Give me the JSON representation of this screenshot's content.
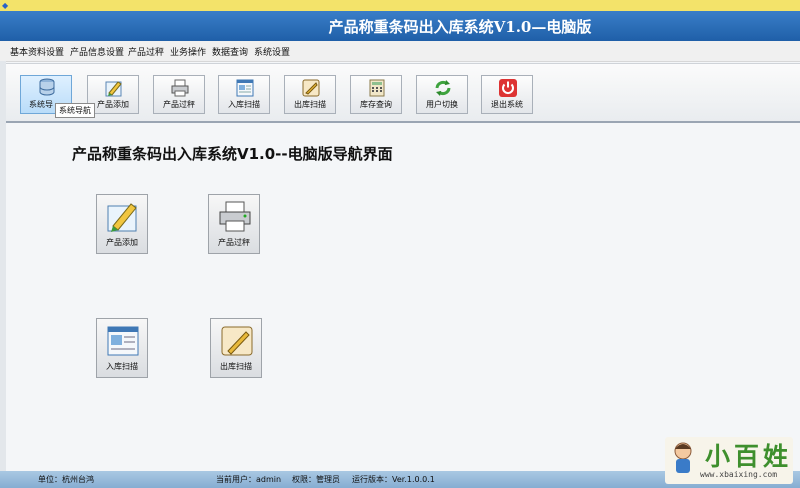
{
  "window": {
    "title": "产品称重条码出入库系统V1.0—电脑版"
  },
  "menu": [
    "基本资料设置",
    "产品信息设置",
    "产品过秤",
    "业务操作",
    "数据查询",
    "系统设置"
  ],
  "toolbar": {
    "buttons": [
      {
        "label": "系统导",
        "icon": "database-icon"
      },
      {
        "label": "产品添加",
        "icon": "pen-icon"
      },
      {
        "label": "产品过秤",
        "icon": "printer-icon"
      },
      {
        "label": "入库扫描",
        "icon": "document-icon"
      },
      {
        "label": "出库扫描",
        "icon": "notepad-icon"
      },
      {
        "label": "库存查询",
        "icon": "calculator-icon"
      },
      {
        "label": "用户切换",
        "icon": "refresh-icon"
      },
      {
        "label": "退出系统",
        "icon": "power-icon"
      }
    ],
    "tooltip": "系统导航"
  },
  "main": {
    "heading": "产品称重条码出入库系统V1.0--电脑版导航界面",
    "tiles": [
      {
        "label": "产品添加",
        "icon": "pen-icon"
      },
      {
        "label": "产品过秤",
        "icon": "printer-icon"
      },
      {
        "label": "入库扫描",
        "icon": "document-icon"
      },
      {
        "label": "出库扫描",
        "icon": "notepad-icon"
      }
    ]
  },
  "status": {
    "unit": "单位：杭州台鸿",
    "user": "当前用户：admin",
    "role": "权限：管理员",
    "version": "运行版本：Ver.1.0.0.1"
  },
  "watermark": {
    "brand": "小百姓",
    "url": "www.xbaixing.com"
  }
}
